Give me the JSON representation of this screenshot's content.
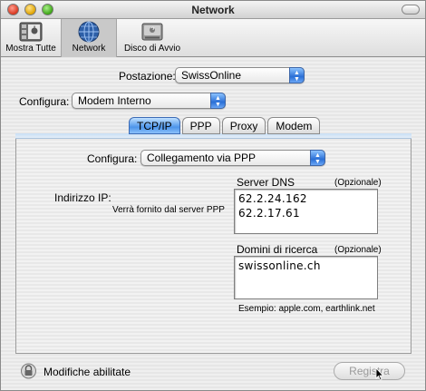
{
  "window": {
    "title": "Network"
  },
  "toolbar": {
    "items": [
      {
        "label": "Mostra Tutte",
        "icon": "show-all-icon"
      },
      {
        "label": "Network",
        "icon": "globe-icon"
      },
      {
        "label": "Disco di Avvio",
        "icon": "startup-disk-icon"
      }
    ]
  },
  "location": {
    "label": "Postazione:",
    "value": "SwissOnline"
  },
  "show": {
    "label": "Configura:",
    "value": "Modem Interno"
  },
  "tabs": [
    "TCP/IP",
    "PPP",
    "Proxy",
    "Modem"
  ],
  "tcpip": {
    "configure_label": "Configura:",
    "configure_value": "Collegamento via PPP",
    "ip_label": "Indirizzo IP:",
    "ip_note": "Verrà fornito dal server PPP",
    "dns_label": "Server DNS",
    "dns_optional": "(Opzionale)",
    "dns_servers": [
      "62.2.24.162",
      "62.2.17.61"
    ],
    "search_label": "Domini di ricerca",
    "search_optional": "(Opzionale)",
    "search_domains": [
      "swissonline.ch"
    ],
    "example": "Esempio: apple.com, earthlink.net"
  },
  "footer": {
    "lock_text": "Modifiche abilitate",
    "apply_label": "Registra"
  },
  "colors": {
    "accent": "#4d95ea",
    "selected_tab": "#4d95ea"
  }
}
